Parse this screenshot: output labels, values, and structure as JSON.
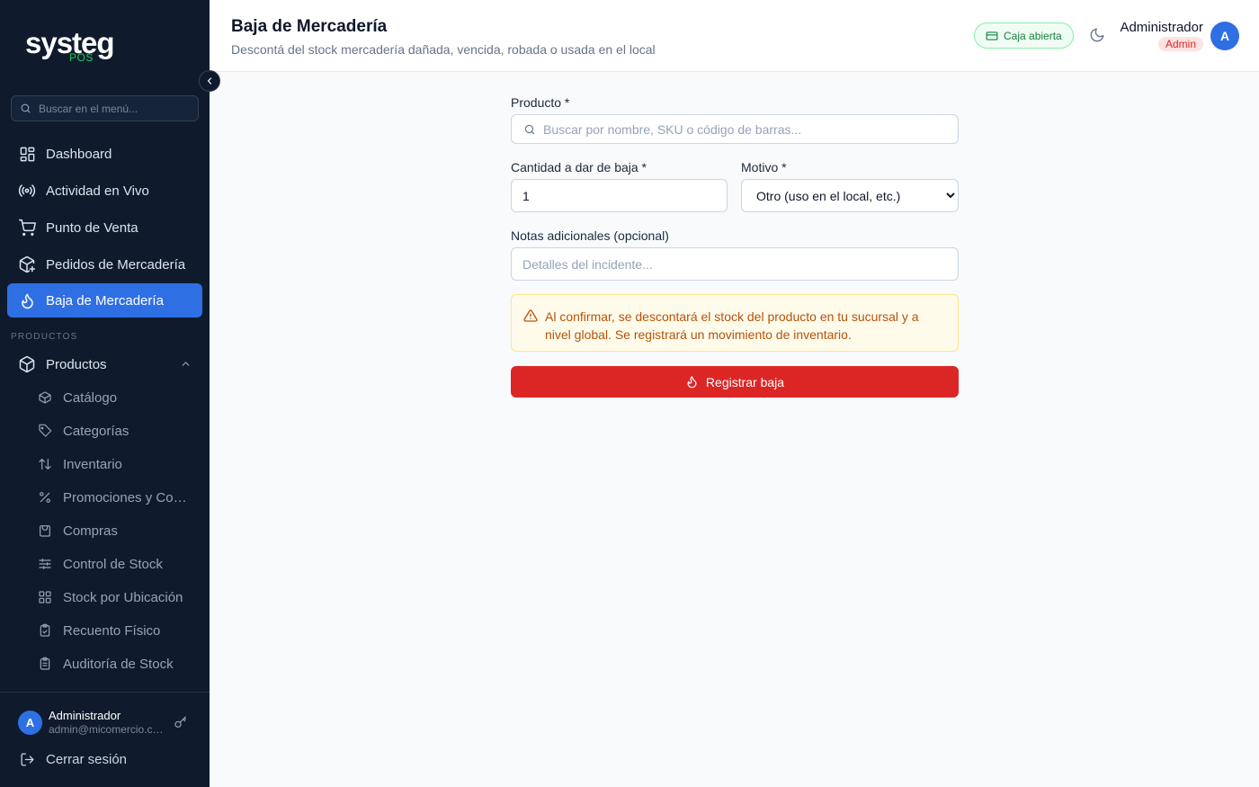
{
  "sidebar": {
    "logo": {
      "main": "systeg",
      "sub": "POS"
    },
    "search_placeholder": "Buscar en el menú...",
    "nav": [
      {
        "label": "Dashboard",
        "icon": "dashboard-icon"
      },
      {
        "label": "Actividad en Vivo",
        "icon": "broadcast-icon"
      },
      {
        "label": "Punto de Venta",
        "icon": "cart-icon"
      },
      {
        "label": "Pedidos de Mercadería",
        "icon": "package-plus-icon"
      },
      {
        "label": "Baja de Mercadería",
        "icon": "flame-icon",
        "active": true
      }
    ],
    "section_label": "PRODUCTOS",
    "group": {
      "label": "Productos",
      "expanded": true
    },
    "subitems": [
      {
        "label": "Catálogo"
      },
      {
        "label": "Categorías"
      },
      {
        "label": "Inventario"
      },
      {
        "label": "Promociones y Combos"
      },
      {
        "label": "Compras"
      },
      {
        "label": "Control de Stock"
      },
      {
        "label": "Stock por Ubicación"
      },
      {
        "label": "Recuento Físico"
      },
      {
        "label": "Auditoría de Stock"
      }
    ],
    "footer": {
      "avatar_initial": "A",
      "user_name": "Administrador",
      "user_email": "admin@micomercio.com",
      "logout_label": "Cerrar sesión"
    }
  },
  "header": {
    "title": "Baja de Mercadería",
    "subtitle": "Descontá del stock mercadería dañada, vencida, robada o usada en el local",
    "cash_status": "Caja abierta",
    "user_name": "Administrador",
    "user_role": "Admin",
    "avatar_initial": "A"
  },
  "form": {
    "product_label": "Producto *",
    "product_placeholder": "Buscar por nombre, SKU o código de barras...",
    "quantity_label": "Cantidad a dar de baja *",
    "quantity_value": "1",
    "reason_label": "Motivo *",
    "reason_selected": "Otro (uso en el local, etc.)",
    "notes_label": "Notas adicionales (opcional)",
    "notes_placeholder": "Detalles del incidente...",
    "alert_line1": "Al confirmar, se descontará el stock del producto en tu sucursal y a",
    "alert_line2": "nivel global. Se registrará un movimiento de inventario.",
    "submit_label": "Registrar baja"
  },
  "colors": {
    "sidebar_bg": "#0f1b2d",
    "accent": "#2f6fe4",
    "danger": "#dc2626",
    "success": "#22c55e",
    "warning_text": "#b45309"
  }
}
